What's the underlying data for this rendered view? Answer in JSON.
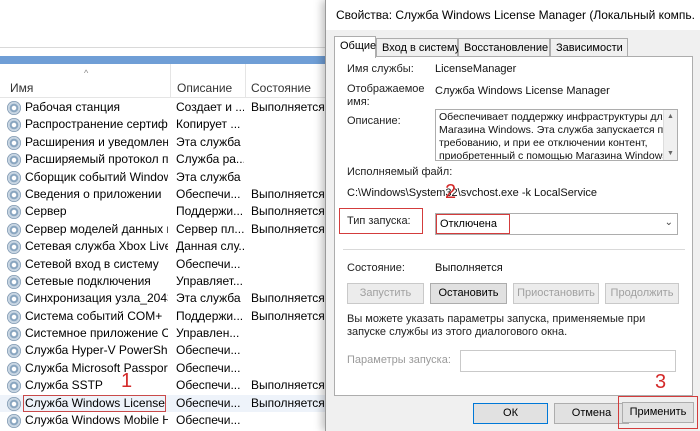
{
  "services_window": {
    "columns": {
      "name": "Имя",
      "description": "Описание",
      "status": "Состояние"
    },
    "rows": [
      {
        "name": "Рабочая станция",
        "desc": "Создает и ...",
        "status": "Выполняется"
      },
      {
        "name": "Распространение сертифи...",
        "desc": "Копирует ...",
        "status": ""
      },
      {
        "name": "Расширения и уведомлен...",
        "desc": "Эта служба ...",
        "status": ""
      },
      {
        "name": "Расширяемый протокол п...",
        "desc": "Служба ра...",
        "status": ""
      },
      {
        "name": "Сборщик событий Windows",
        "desc": "Эта служба ...",
        "status": ""
      },
      {
        "name": "Сведения о приложении",
        "desc": "Обеспечи...",
        "status": "Выполняется"
      },
      {
        "name": "Сервер",
        "desc": "Поддержи...",
        "status": "Выполняется"
      },
      {
        "name": "Сервер моделей данных п...",
        "desc": "Сервер пл...",
        "status": "Выполняется"
      },
      {
        "name": "Сетевая служба Xbox Live",
        "desc": "Данная слу...",
        "status": ""
      },
      {
        "name": "Сетевой вход в систему",
        "desc": "Обеспечи...",
        "status": ""
      },
      {
        "name": "Сетевые подключения",
        "desc": "Управляет...",
        "status": ""
      },
      {
        "name": "Синхронизация узла_2043...",
        "desc": "Эта служба ...",
        "status": "Выполняется"
      },
      {
        "name": "Система событий COM+",
        "desc": "Поддержи...",
        "status": "Выполняется"
      },
      {
        "name": "Системное приложение C...",
        "desc": "Управлен...",
        "status": ""
      },
      {
        "name": "Служба Hyper-V PowerShe...",
        "desc": "Обеспечи...",
        "status": ""
      },
      {
        "name": "Служба Microsoft Passport",
        "desc": "Обеспечи...",
        "status": ""
      },
      {
        "name": "Служба SSTP",
        "desc": "Обеспечи...",
        "status": "Выполняется"
      },
      {
        "name": "Служба Windows License ...",
        "desc": "Обеспечи...",
        "status": "Выполняется"
      },
      {
        "name": "Служба Windows Mobile H...",
        "desc": "Обеспечи...",
        "status": ""
      }
    ],
    "selected_index": 17
  },
  "markers": {
    "m1": "1",
    "m2": "2",
    "m3": "3"
  },
  "dialog": {
    "title": "Свойства: Служба Windows License Manager (Локальный компь...",
    "tabs": [
      "Общие",
      "Вход в систему",
      "Восстановление",
      "Зависимости"
    ],
    "service_name_label": "Имя службы:",
    "service_name_value": "LicenseManager",
    "display_name_label": "Отображаемое имя:",
    "display_name_value": "Служба Windows License Manager",
    "description_label": "Описание:",
    "description_value": "Обеспечивает поддержку инфраструктуры для Магазина Windows. Эта служба запускается по требованию, и при ее отключении контент, приобретенный с помощью Магазина Windows,",
    "exe_label": "Исполняемый файл:",
    "exe_value": "C:\\Windows\\System32\\svchost.exe -k LocalService",
    "startup_label": "Тип запуска:",
    "startup_value": "Отключена",
    "status_label": "Состояние:",
    "status_value": "Выполняется",
    "buttons": {
      "start": "Запустить",
      "stop": "Остановить",
      "pause": "Приостановить",
      "resume": "Продолжить"
    },
    "hint": "Вы можете указать параметры запуска, применяемые при запуске службы из этого диалогового окна.",
    "params_label": "Параметры запуска:",
    "ok": "ОК",
    "cancel": "Отмена",
    "apply": "Применить"
  }
}
